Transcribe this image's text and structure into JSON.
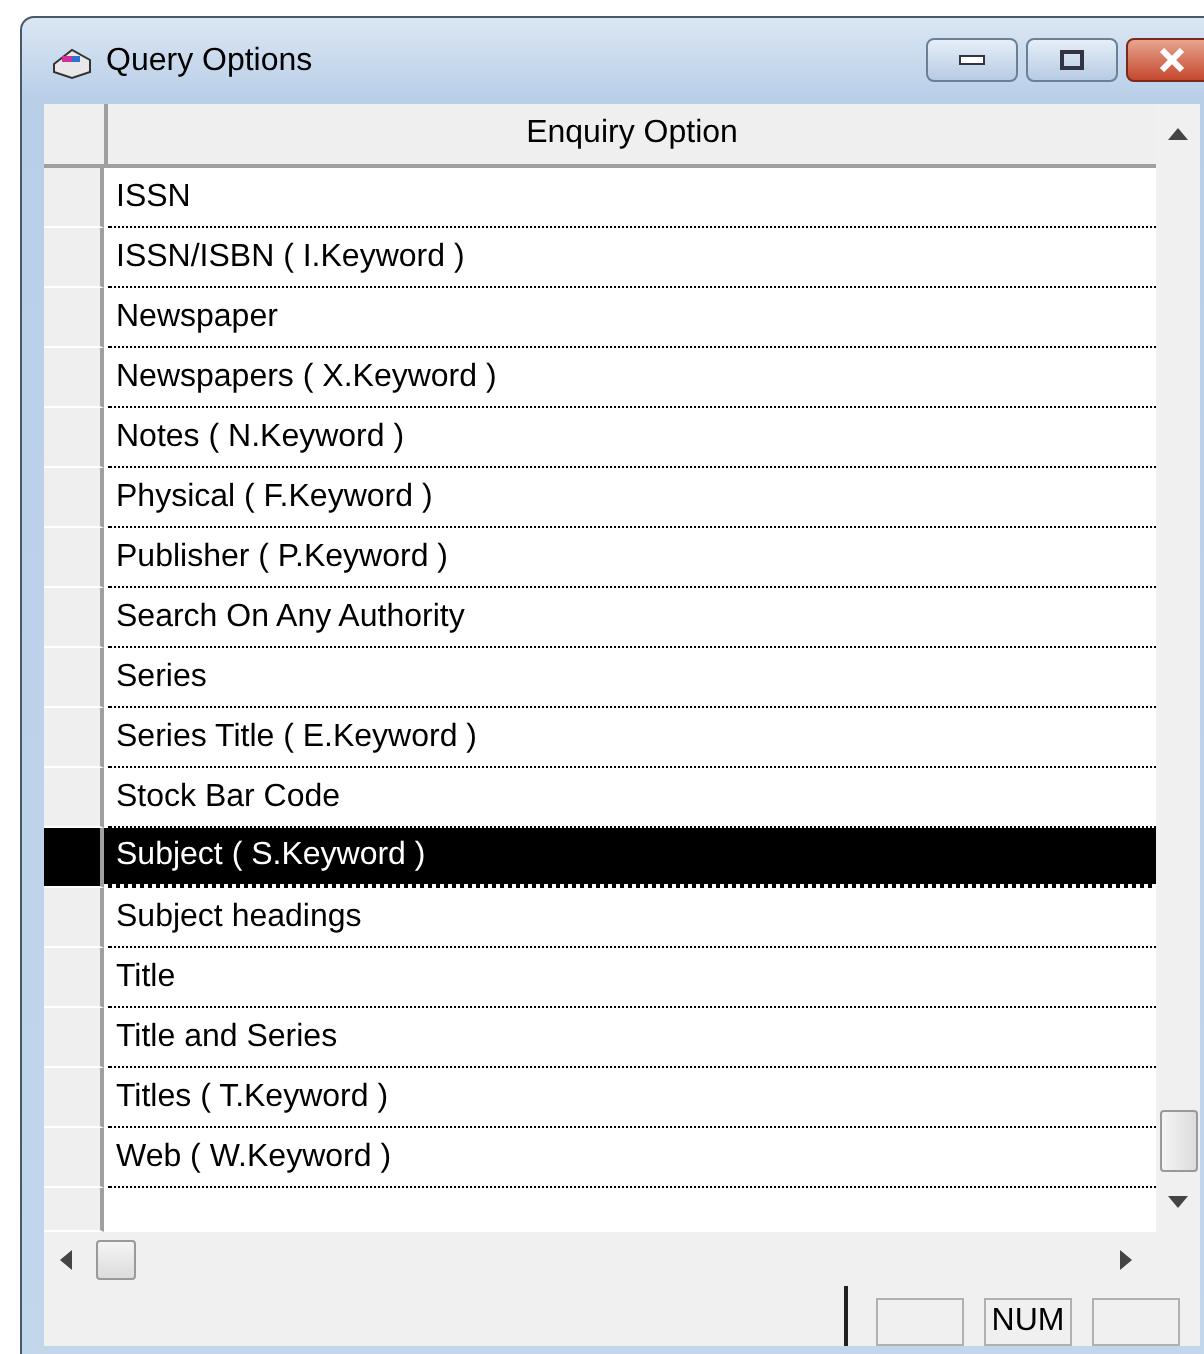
{
  "window": {
    "title": "Query Options"
  },
  "grid": {
    "columns": [
      "Enquiry Option"
    ],
    "rows": [
      {
        "label": "ISSN",
        "selected": false
      },
      {
        "label": "ISSN/ISBN ( I.Keyword )",
        "selected": false
      },
      {
        "label": "Newspaper",
        "selected": false
      },
      {
        "label": "Newspapers ( X.Keyword )",
        "selected": false
      },
      {
        "label": "Notes ( N.Keyword )",
        "selected": false
      },
      {
        "label": "Physical ( F.Keyword )",
        "selected": false
      },
      {
        "label": "Publisher ( P.Keyword )",
        "selected": false
      },
      {
        "label": "Search On Any Authority",
        "selected": false
      },
      {
        "label": "Series",
        "selected": false
      },
      {
        "label": "Series Title ( E.Keyword )",
        "selected": false
      },
      {
        "label": "Stock Bar Code",
        "selected": false
      },
      {
        "label": "Subject ( S.Keyword )",
        "selected": true
      },
      {
        "label": "Subject headings",
        "selected": false
      },
      {
        "label": "Title",
        "selected": false
      },
      {
        "label": "Title and Series",
        "selected": false
      },
      {
        "label": "Titles ( T.Keyword )",
        "selected": false
      },
      {
        "label": "Web ( W.Keyword )",
        "selected": false
      }
    ]
  },
  "status_bar": {
    "num_indicator": "NUM"
  }
}
